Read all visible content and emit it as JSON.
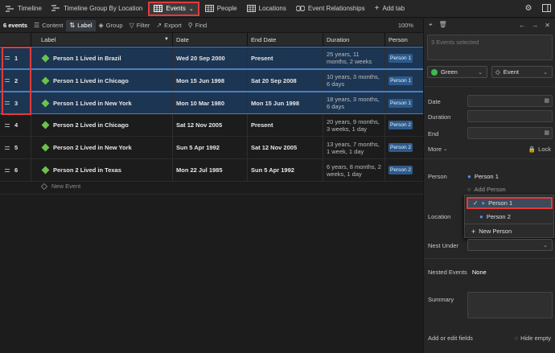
{
  "tabs": [
    {
      "label": "Timeline",
      "icon": "timeline-icon"
    },
    {
      "label": "Timeline Group By Location",
      "icon": "timeline-group-icon"
    },
    {
      "label": "Events",
      "icon": "table-icon"
    },
    {
      "label": "People",
      "icon": "table-icon"
    },
    {
      "label": "Locations",
      "icon": "table-icon"
    },
    {
      "label": "Event Relationships",
      "icon": "relationships-icon"
    },
    {
      "label": "Add tab",
      "icon": "plus-icon"
    }
  ],
  "toolbar": {
    "count": "6 events",
    "content": "Content",
    "label": "Label",
    "group": "Group",
    "filter": "Filter",
    "export": "Export",
    "find": "Find",
    "zoom": "100%"
  },
  "table": {
    "columns": [
      "Label",
      "Date",
      "End Date",
      "Duration",
      "Person"
    ],
    "rows": [
      {
        "num": "1",
        "label": "Person 1 Lived in Brazil",
        "date": "Wed 20 Sep 2000",
        "end": "Present",
        "duration": "25 years, 11 months, 2 weeks",
        "person": "Person 1",
        "selected": true
      },
      {
        "num": "2",
        "label": "Person 1 Lived in Chicago",
        "date": "Mon 15 Jun 1998",
        "end": "Sat 20 Sep 2008",
        "duration": "10 years, 3 months, 6 days",
        "person": "Person 1",
        "selected": true
      },
      {
        "num": "3",
        "label": "Person 1 Lived in New York",
        "date": "Mon 10 Mar 1980",
        "end": "Mon 15 Jun 1998",
        "duration": "18 years, 3 months, 6 days",
        "person": "Person 1",
        "selected": true
      },
      {
        "num": "4",
        "label": "Person 2 Lived in Chicago",
        "date": "Sat 12 Nov 2005",
        "end": "Present",
        "duration": "20 years, 9 months, 3 weeks, 1 day",
        "person": "Person 2",
        "selected": false
      },
      {
        "num": "5",
        "label": "Person 2 Lived in New York",
        "date": "Sun 5 Apr 1992",
        "end": "Sat 12 Nov 2005",
        "duration": "13 years, 7 months, 1 week, 1 day",
        "person": "Person 2",
        "selected": false
      },
      {
        "num": "6",
        "label": "Person 2 Lived in Texas",
        "date": "Mon 22 Jul 1985",
        "end": "Sun 5 Apr 1992",
        "duration": "6 years, 8 months, 2 weeks, 1 day",
        "person": "Person 2",
        "selected": false
      }
    ],
    "new_event": "New Event"
  },
  "panel": {
    "placeholder": "3 Events selected",
    "color": "Green",
    "type": "Event",
    "date": "Date",
    "duration": "Duration",
    "end": "End",
    "more": "More",
    "lock": "Lock",
    "person_label": "Person",
    "person_value": "Person 1",
    "add_person": "Add Person",
    "location": "Location",
    "dropdown": [
      "Person 1",
      "Person 2"
    ],
    "new_person": "New Person",
    "nest_under": "Nest Under",
    "nested_events": "Nested Events",
    "nested_value": "None",
    "summary": "Summary",
    "add_fields": "Add or edit fields",
    "hide_empty": "Hide empty"
  },
  "colors": {
    "accent": "#e23b3b",
    "selection": "#1c3552",
    "green": "#6cc24a",
    "person": "#2d5b8a"
  }
}
